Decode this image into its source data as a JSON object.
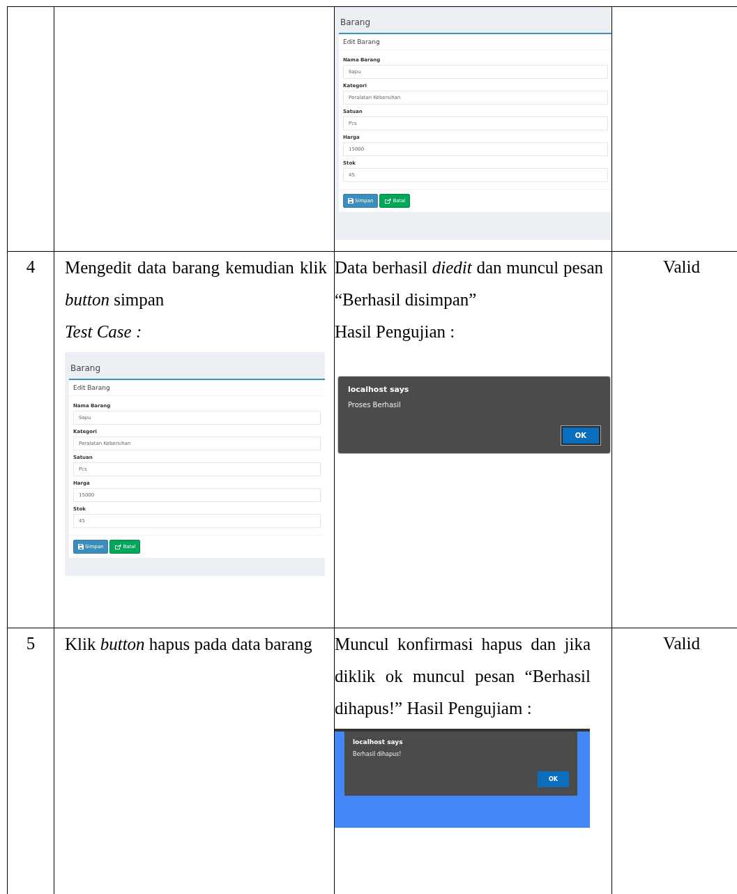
{
  "rows": [
    {
      "number": "",
      "scenario": [],
      "scenario_shot": null,
      "result": [],
      "result_shot": {
        "kind": "form",
        "title": "Barang",
        "panel": "Edit Barang",
        "fields": [
          {
            "label": "Nama Barang",
            "value": "Sapu"
          },
          {
            "label": "Kategori",
            "value": "Peralatan Kebersihan"
          },
          {
            "label": "Satuan",
            "value": "Pcs"
          },
          {
            "label": "Harga",
            "value": "15000"
          },
          {
            "label": "Stok",
            "value": "45"
          }
        ],
        "buttons": [
          {
            "label": "Simpan",
            "kind": "save"
          },
          {
            "label": "Batal",
            "kind": "cancel"
          }
        ]
      },
      "conclusion": ""
    },
    {
      "number": "4",
      "scenario": [
        {
          "text": "Mengedit data barang kemudian klik  *button* simpan",
          "kind": "plain"
        },
        {
          "text": "Test Case :",
          "kind": "italic"
        }
      ],
      "scenario_shot": {
        "kind": "form",
        "title": "Barang",
        "panel": "Edit Barang",
        "fields": [
          {
            "label": "Nama Barang",
            "value": "Sapu"
          },
          {
            "label": "Kategori",
            "value": "Peralatan Kebersihan"
          },
          {
            "label": "Satuan",
            "value": "Pcs"
          },
          {
            "label": "Harga",
            "value": "15000"
          },
          {
            "label": "Stok",
            "value": "45"
          }
        ],
        "buttons": [
          {
            "label": "Simpan",
            "kind": "save"
          },
          {
            "label": "Batal",
            "kind": "cancel"
          }
        ]
      },
      "result": [
        {
          "text": "Data berhasil *diedit* dan muncul pesan “Berhasil disimpan”",
          "kind": "plain"
        },
        {
          "text": "Hasil Pengujian :",
          "kind": "plain"
        }
      ],
      "result_shot": {
        "kind": "alert",
        "title": "localhost says",
        "message": "Proses Berhasil",
        "button": "OK"
      },
      "conclusion": "Valid"
    },
    {
      "number": "5",
      "scenario": [
        {
          "text": "Klik *button* hapus pada data barang",
          "kind": "plain"
        }
      ],
      "scenario_shot": null,
      "result": [
        {
          "text": "Muncul konfirmasi hapus dan jika diklik ok muncul pesan “Berhasil dihapus!” Hasil Pengujiam :",
          "kind": "plain"
        }
      ],
      "result_shot": {
        "kind": "popup",
        "title": "localhost says",
        "message": "Berhasil dihapus!",
        "button": "OK"
      },
      "conclusion": "Valid"
    }
  ]
}
